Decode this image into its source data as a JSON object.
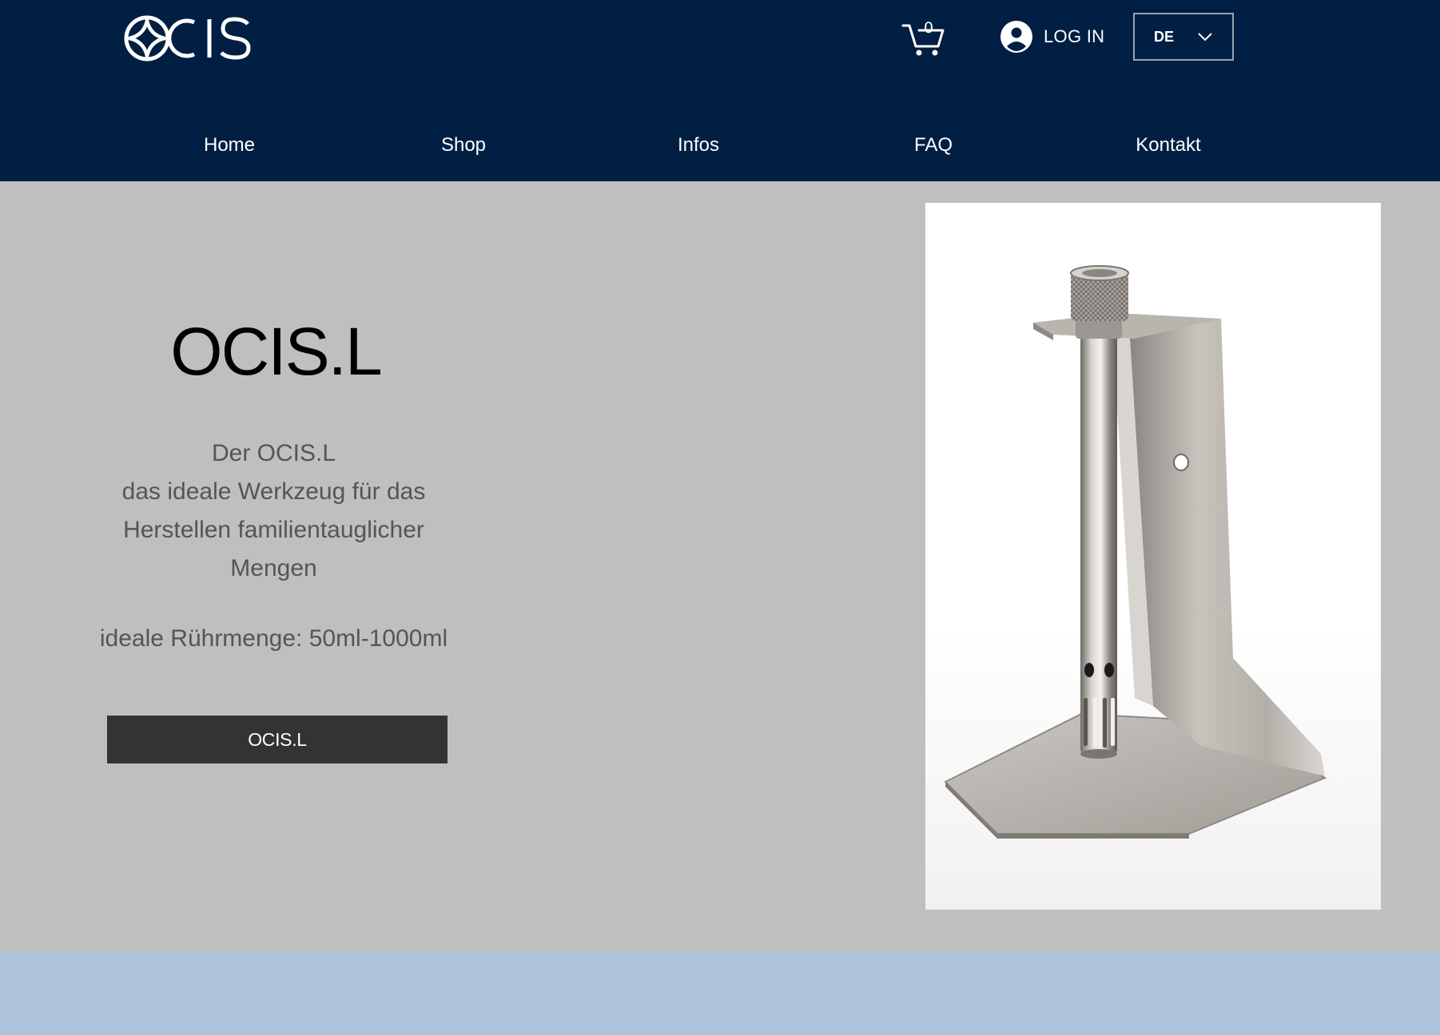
{
  "header": {
    "logo_text": "OCIS",
    "cart": {
      "count": "0",
      "icon": "cart-icon"
    },
    "login": {
      "label": "LOG IN",
      "icon": "user-avatar-icon"
    },
    "language": {
      "value": "DE",
      "icon": "chevron-down-icon"
    },
    "nav": [
      {
        "label": "Home"
      },
      {
        "label": "Shop"
      },
      {
        "label": "Infos"
      },
      {
        "label": "FAQ"
      },
      {
        "label": "Kontakt"
      }
    ]
  },
  "hero": {
    "title": "OCIS.L",
    "description_lines": [
      "Der OCIS.L",
      "das ideale Werkzeug für das",
      "Herstellen familientauglicher",
      "Mengen"
    ],
    "range": "ideale Rührmenge: 50ml-1000ml",
    "button_label": "OCIS.L"
  },
  "colors": {
    "header_bg": "#001f43",
    "main_bg": "#bfbfbf",
    "button_bg": "#333333",
    "footer_bg": "#adc4da"
  }
}
